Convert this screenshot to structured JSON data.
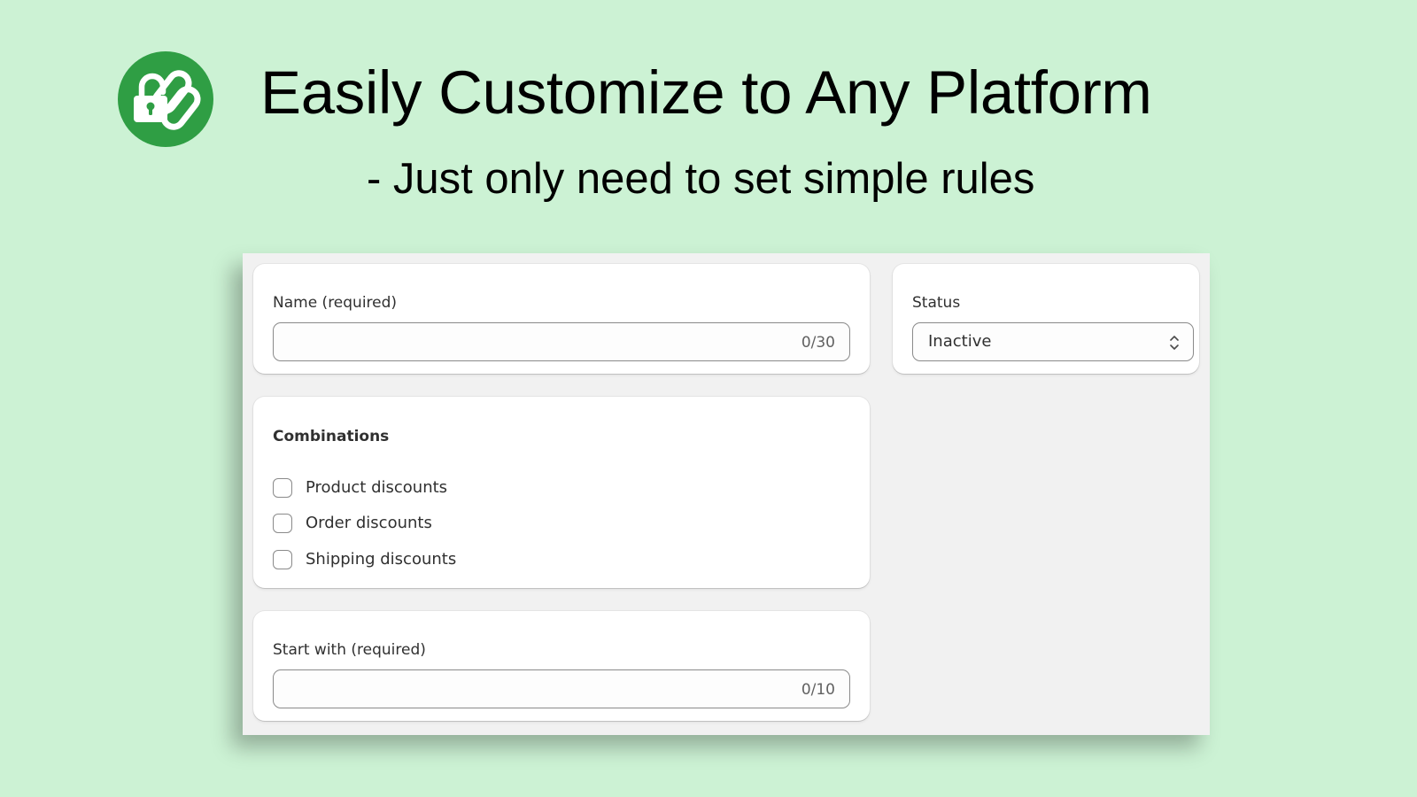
{
  "banner": {
    "title": "Easily Customize to Any Platform",
    "subtitle": "- Just only need to set simple rules",
    "logo_icon": "lock-link-icon",
    "logo_color": "#2f9e44",
    "background_color": "#ccf2d4"
  },
  "form": {
    "name_card": {
      "label": "Name (required)",
      "value": "",
      "counter": "0/30"
    },
    "status_card": {
      "label": "Status",
      "selected": "Inactive",
      "icon": "select-chevrons-icon"
    },
    "combinations_card": {
      "heading": "Combinations",
      "options": [
        {
          "label": "Product discounts",
          "checked": false
        },
        {
          "label": "Order discounts",
          "checked": false
        },
        {
          "label": "Shipping discounts",
          "checked": false
        }
      ]
    },
    "start_card": {
      "label": "Start with (required)",
      "value": "",
      "counter": "0/10"
    }
  }
}
